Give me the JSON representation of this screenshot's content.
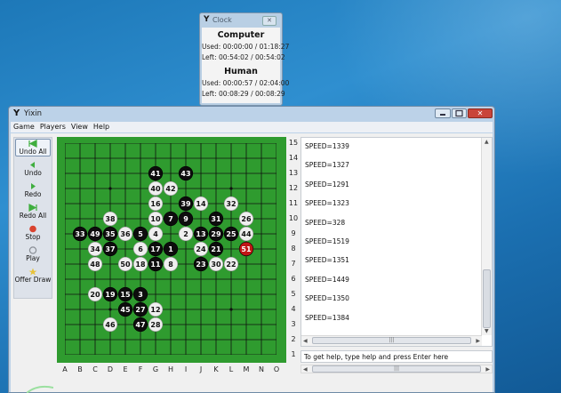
{
  "clock": {
    "title": "Clock",
    "players": [
      {
        "name": "Computer",
        "used": "Used: 00:00:00 / 01:18:27",
        "left": "Left: 00:54:02 / 00:54:02"
      },
      {
        "name": "Human",
        "used": "Used: 00:00:57 / 02:04:00",
        "left": "Left: 00:08:29 / 00:08:29"
      }
    ]
  },
  "window": {
    "title": "Yixin",
    "menu": [
      "Game",
      "Players",
      "View",
      "Help"
    ]
  },
  "toolbar": [
    {
      "label": "Undo All",
      "icon": "undo-all-icon",
      "color": "#3fae3f"
    },
    {
      "label": "Undo",
      "icon": "undo-icon",
      "color": "#3fae3f"
    },
    {
      "label": "Redo",
      "icon": "redo-icon",
      "color": "#3fae3f"
    },
    {
      "label": "Redo All",
      "icon": "redo-all-icon",
      "color": "#3fae3f"
    },
    {
      "label": "Stop",
      "icon": "stop-icon",
      "color": "#d9432f"
    },
    {
      "label": "Play",
      "icon": "play-icon",
      "color": "#8a8f96"
    },
    {
      "label": "Offer Draw",
      "icon": "offer-draw-icon",
      "color": "#e8c23a"
    }
  ],
  "board": {
    "columns": [
      "A",
      "B",
      "C",
      "D",
      "E",
      "F",
      "G",
      "H",
      "I",
      "J",
      "K",
      "L",
      "M",
      "N",
      "O"
    ],
    "rows": [
      "15",
      "14",
      "13",
      "12",
      "11",
      "10",
      "9",
      "8",
      "7",
      "6",
      "5",
      "4",
      "3",
      "2",
      "1"
    ],
    "colors": {
      "board": "#2f9b2f",
      "black": "#0d0d0d",
      "white": "#efefef",
      "last": "#c01616"
    },
    "stones": [
      {
        "n": "1",
        "color": "black",
        "col": "H",
        "row": 8
      },
      {
        "n": "2",
        "color": "white",
        "col": "I",
        "row": 9
      },
      {
        "n": "3",
        "color": "black",
        "col": "F",
        "row": 5
      },
      {
        "n": "4",
        "color": "white",
        "col": "G",
        "row": 9
      },
      {
        "n": "5",
        "color": "black",
        "col": "F",
        "row": 9
      },
      {
        "n": "6",
        "color": "white",
        "col": "F",
        "row": 8
      },
      {
        "n": "7",
        "color": "black",
        "col": "H",
        "row": 10
      },
      {
        "n": "8",
        "color": "white",
        "col": "H",
        "row": 7
      },
      {
        "n": "9",
        "color": "black",
        "col": "I",
        "row": 10
      },
      {
        "n": "10",
        "color": "white",
        "col": "G",
        "row": 10
      },
      {
        "n": "11",
        "color": "black",
        "col": "G",
        "row": 7
      },
      {
        "n": "12",
        "color": "white",
        "col": "G",
        "row": 4
      },
      {
        "n": "13",
        "color": "black",
        "col": "J",
        "row": 9
      },
      {
        "n": "14",
        "color": "white",
        "col": "J",
        "row": 11
      },
      {
        "n": "15",
        "color": "black",
        "col": "E",
        "row": 5
      },
      {
        "n": "16",
        "color": "white",
        "col": "G",
        "row": 11
      },
      {
        "n": "17",
        "color": "black",
        "col": "G",
        "row": 8
      },
      {
        "n": "18",
        "color": "white",
        "col": "F",
        "row": 7
      },
      {
        "n": "19",
        "color": "black",
        "col": "D",
        "row": 5
      },
      {
        "n": "20",
        "color": "white",
        "col": "C",
        "row": 5
      },
      {
        "n": "21",
        "color": "black",
        "col": "K",
        "row": 8
      },
      {
        "n": "22",
        "color": "white",
        "col": "L",
        "row": 7
      },
      {
        "n": "23",
        "color": "black",
        "col": "J",
        "row": 7
      },
      {
        "n": "24",
        "color": "white",
        "col": "J",
        "row": 8
      },
      {
        "n": "25",
        "color": "black",
        "col": "L",
        "row": 9
      },
      {
        "n": "26",
        "color": "white",
        "col": "M",
        "row": 10
      },
      {
        "n": "27",
        "color": "black",
        "col": "F",
        "row": 4
      },
      {
        "n": "28",
        "color": "white",
        "col": "G",
        "row": 3
      },
      {
        "n": "29",
        "color": "black",
        "col": "K",
        "row": 9
      },
      {
        "n": "30",
        "color": "white",
        "col": "K",
        "row": 7
      },
      {
        "n": "31",
        "color": "black",
        "col": "K",
        "row": 10
      },
      {
        "n": "32",
        "color": "white",
        "col": "L",
        "row": 11
      },
      {
        "n": "33",
        "color": "black",
        "col": "B",
        "row": 9
      },
      {
        "n": "34",
        "color": "white",
        "col": "C",
        "row": 8
      },
      {
        "n": "35",
        "color": "black",
        "col": "D",
        "row": 9
      },
      {
        "n": "36",
        "color": "white",
        "col": "E",
        "row": 9
      },
      {
        "n": "37",
        "color": "black",
        "col": "D",
        "row": 8
      },
      {
        "n": "38",
        "color": "white",
        "col": "D",
        "row": 10
      },
      {
        "n": "39",
        "color": "black",
        "col": "I",
        "row": 11
      },
      {
        "n": "40",
        "color": "white",
        "col": "G",
        "row": 12
      },
      {
        "n": "41",
        "color": "black",
        "col": "G",
        "row": 13
      },
      {
        "n": "42",
        "color": "white",
        "col": "H",
        "row": 12
      },
      {
        "n": "43",
        "color": "black",
        "col": "I",
        "row": 13
      },
      {
        "n": "44",
        "color": "white",
        "col": "M",
        "row": 9
      },
      {
        "n": "45",
        "color": "black",
        "col": "E",
        "row": 4
      },
      {
        "n": "46",
        "color": "white",
        "col": "D",
        "row": 3
      },
      {
        "n": "47",
        "color": "black",
        "col": "F",
        "row": 3
      },
      {
        "n": "48",
        "color": "white",
        "col": "C",
        "row": 7
      },
      {
        "n": "49",
        "color": "black",
        "col": "C",
        "row": 9
      },
      {
        "n": "50",
        "color": "white",
        "col": "E",
        "row": 7
      },
      {
        "n": "51",
        "color": "last",
        "col": "M",
        "row": 8
      }
    ]
  },
  "log": [
    "SPEED=1339",
    "SPEED=1327",
    "SPEED=1291",
    "SPEED=1323",
    "SPEED=328",
    "SPEED=1519",
    "SPEED=1351",
    "SPEED=1449",
    "SPEED=1350",
    "SPEED=1384"
  ],
  "command": {
    "placeholder": "To get help, type help and press Enter here"
  }
}
